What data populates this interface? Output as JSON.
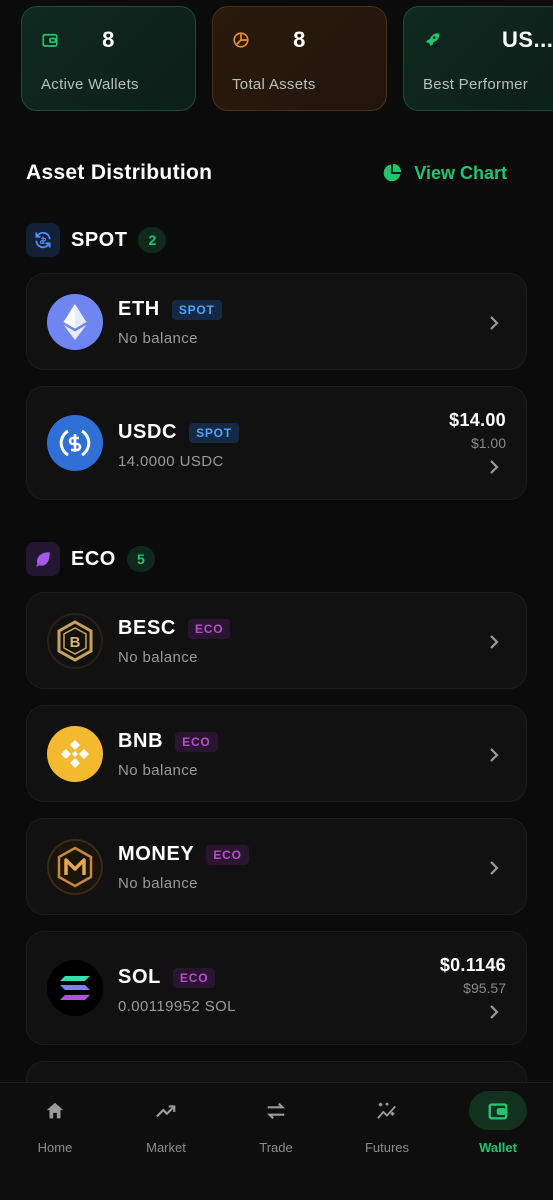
{
  "stats": [
    {
      "value": "8",
      "label": "Active Wallets",
      "icon": "wallet-icon"
    },
    {
      "value": "8",
      "label": "Total Assets",
      "icon": "pie-chart-icon"
    },
    {
      "value": "US...",
      "label": "Best Performer",
      "icon": "rocket-icon"
    }
  ],
  "section": {
    "title": "Asset Distribution",
    "view_chart": "View Chart"
  },
  "groups": {
    "spot": {
      "name": "SPOT",
      "count": "2"
    },
    "eco": {
      "name": "ECO",
      "count": "5"
    }
  },
  "assets": [
    {
      "symbol": "ETH",
      "tag": "SPOT",
      "sub": "No balance"
    },
    {
      "symbol": "USDC",
      "tag": "SPOT",
      "sub": "14.0000 USDC",
      "value": "$14.00",
      "unit_price": "$1.00"
    },
    {
      "symbol": "BESC",
      "tag": "ECO",
      "sub": "No balance"
    },
    {
      "symbol": "BNB",
      "tag": "ECO",
      "sub": "No balance"
    },
    {
      "symbol": "MONEY",
      "tag": "ECO",
      "sub": "No balance"
    },
    {
      "symbol": "SOL",
      "tag": "ECO",
      "sub": "0.00119952 SOL",
      "value": "$0.1146",
      "unit_price": "$95.57"
    }
  ],
  "nav": [
    {
      "label": "Home",
      "icon": "home-icon"
    },
    {
      "label": "Market",
      "icon": "trending-up-icon"
    },
    {
      "label": "Trade",
      "icon": "swap-arrows-icon"
    },
    {
      "label": "Futures",
      "icon": "sparkle-chart-icon"
    },
    {
      "label": "Wallet",
      "icon": "wallet-icon",
      "active": true
    }
  ],
  "colors": {
    "accent": "#22c56e",
    "spot_tag": "#4fa3ff",
    "eco_tag": "#b94bd0",
    "background": "#0b0b0b"
  }
}
